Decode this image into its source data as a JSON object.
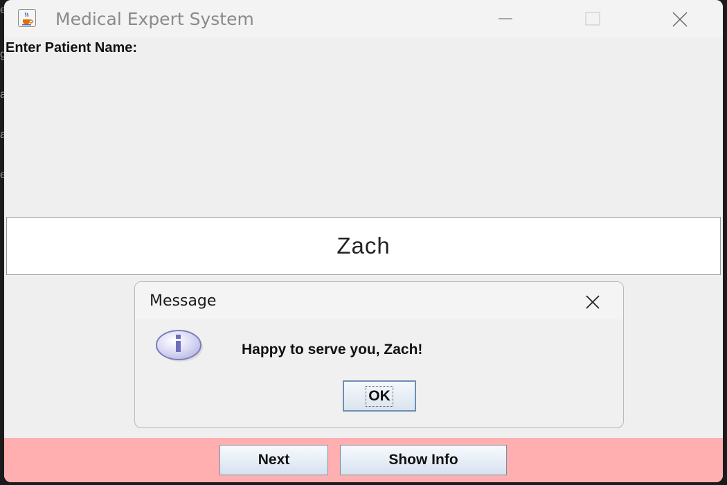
{
  "window": {
    "title": "Medical Expert System",
    "icon": "java-cup-icon",
    "controls": [
      "minimize-icon",
      "maximize-icon",
      "close-icon"
    ]
  },
  "form": {
    "prompt_label": "Enter Patient Name:",
    "name_value": "Zach"
  },
  "dialog": {
    "title": "Message",
    "icon": "info-icon",
    "message": "Happy to serve you, Zach!",
    "ok_label": "OK"
  },
  "bottom_bar": {
    "background": "#ffafaf",
    "next_label": "Next",
    "show_info_label": "Show Info"
  }
}
